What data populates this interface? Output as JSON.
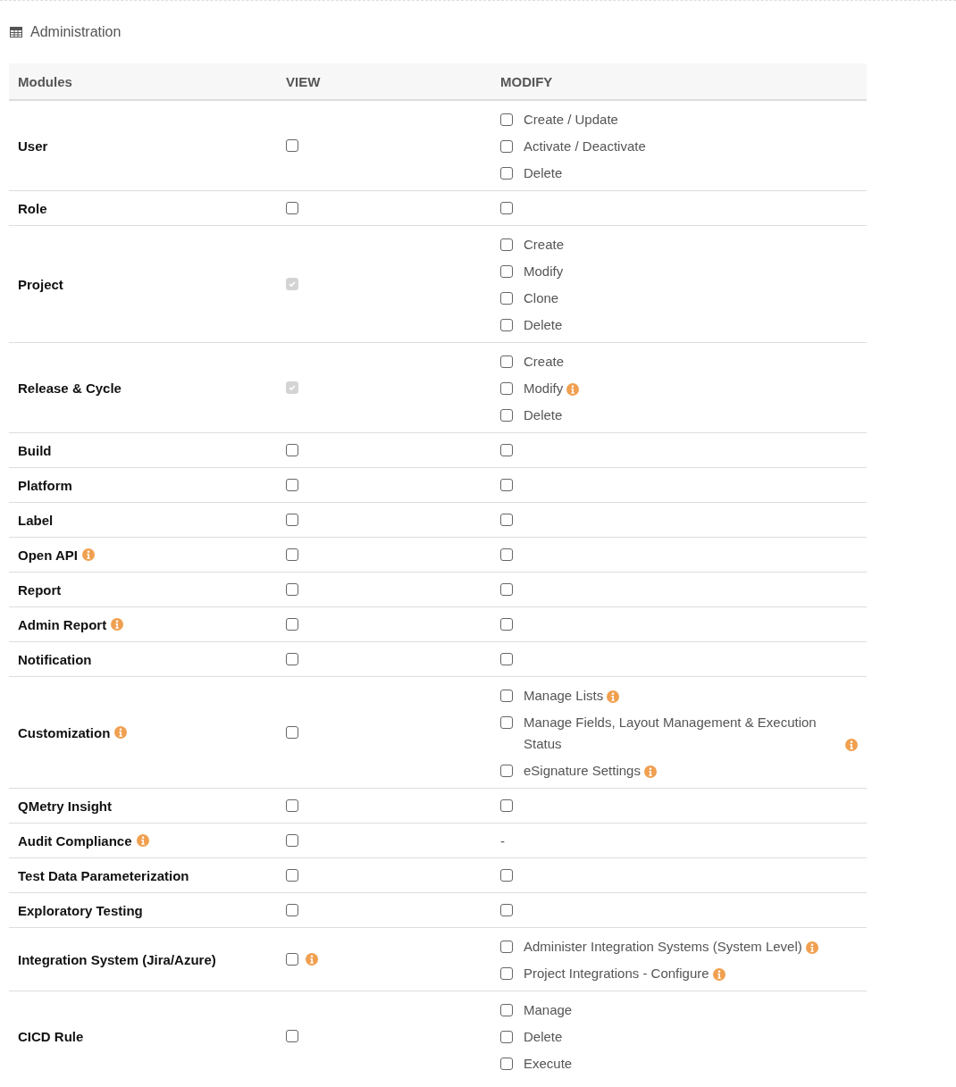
{
  "section": {
    "title": "Administration"
  },
  "columns": [
    "Modules",
    "VIEW",
    "MODIFY"
  ],
  "rows": [
    {
      "module": "User",
      "info": false,
      "view": {
        "checked": false,
        "disabled": false,
        "info": false
      },
      "modify": {
        "kind": "options",
        "options": [
          {
            "label": "Create / Update",
            "checked": false,
            "info": false
          },
          {
            "label": "Activate / Deactivate",
            "checked": false,
            "info": false
          },
          {
            "label": "Delete",
            "checked": false,
            "info": false
          }
        ]
      }
    },
    {
      "module": "Role",
      "info": false,
      "view": {
        "checked": false,
        "disabled": false,
        "info": false
      },
      "modify": {
        "kind": "checkbox",
        "checked": false
      }
    },
    {
      "module": "Project",
      "info": false,
      "view": {
        "checked": true,
        "disabled": true,
        "info": false
      },
      "modify": {
        "kind": "options",
        "options": [
          {
            "label": "Create",
            "checked": false,
            "info": false
          },
          {
            "label": "Modify",
            "checked": false,
            "info": false
          },
          {
            "label": "Clone",
            "checked": false,
            "info": false
          },
          {
            "label": "Delete",
            "checked": false,
            "info": false
          }
        ]
      }
    },
    {
      "module": "Release & Cycle",
      "info": false,
      "view": {
        "checked": true,
        "disabled": true,
        "info": false
      },
      "modify": {
        "kind": "options",
        "options": [
          {
            "label": "Create",
            "checked": false,
            "info": false
          },
          {
            "label": "Modify",
            "checked": false,
            "info": true
          },
          {
            "label": "Delete",
            "checked": false,
            "info": false
          }
        ]
      }
    },
    {
      "module": "Build",
      "info": false,
      "view": {
        "checked": false,
        "disabled": false,
        "info": false
      },
      "modify": {
        "kind": "checkbox",
        "checked": false
      }
    },
    {
      "module": "Platform",
      "info": false,
      "view": {
        "checked": false,
        "disabled": false,
        "info": false
      },
      "modify": {
        "kind": "checkbox",
        "checked": false
      }
    },
    {
      "module": "Label",
      "info": false,
      "view": {
        "checked": false,
        "disabled": false,
        "info": false
      },
      "modify": {
        "kind": "checkbox",
        "checked": false
      }
    },
    {
      "module": "Open API",
      "info": true,
      "view": {
        "checked": false,
        "disabled": false,
        "info": false
      },
      "modify": {
        "kind": "checkbox",
        "checked": false
      }
    },
    {
      "module": "Report",
      "info": false,
      "view": {
        "checked": false,
        "disabled": false,
        "info": false
      },
      "modify": {
        "kind": "checkbox",
        "checked": false
      }
    },
    {
      "module": "Admin Report",
      "info": true,
      "view": {
        "checked": false,
        "disabled": false,
        "info": false
      },
      "modify": {
        "kind": "checkbox",
        "checked": false
      }
    },
    {
      "module": "Notification",
      "info": false,
      "view": {
        "checked": false,
        "disabled": false,
        "info": false
      },
      "modify": {
        "kind": "checkbox",
        "checked": false
      }
    },
    {
      "module": "Customization",
      "info": true,
      "view": {
        "checked": false,
        "disabled": false,
        "info": false
      },
      "modify": {
        "kind": "options",
        "options": [
          {
            "label": "Manage Lists",
            "checked": false,
            "info": true
          },
          {
            "label": "Manage Fields, Layout Management & Execution Status",
            "checked": false,
            "info": true
          },
          {
            "label": "eSignature Settings",
            "checked": false,
            "info": true
          }
        ]
      }
    },
    {
      "module": "QMetry Insight",
      "info": false,
      "view": {
        "checked": false,
        "disabled": false,
        "info": false
      },
      "modify": {
        "kind": "checkbox",
        "checked": false
      }
    },
    {
      "module": "Audit Compliance",
      "info": true,
      "view": {
        "checked": false,
        "disabled": false,
        "info": false
      },
      "modify": {
        "kind": "text",
        "text": "-"
      }
    },
    {
      "module": "Test Data Parameterization",
      "info": false,
      "view": {
        "checked": false,
        "disabled": false,
        "info": false
      },
      "modify": {
        "kind": "checkbox",
        "checked": false
      }
    },
    {
      "module": "Exploratory Testing",
      "info": false,
      "view": {
        "checked": false,
        "disabled": false,
        "info": false
      },
      "modify": {
        "kind": "checkbox",
        "checked": false
      }
    },
    {
      "module": "Integration System (Jira/Azure)",
      "info": false,
      "view": {
        "checked": false,
        "disabled": false,
        "info": true
      },
      "modify": {
        "kind": "options",
        "options": [
          {
            "label": "Administer Integration Systems (System Level)",
            "checked": false,
            "info": true
          },
          {
            "label": "Project Integrations - Configure",
            "checked": false,
            "info": true
          }
        ]
      }
    },
    {
      "module": "CICD Rule",
      "info": false,
      "view": {
        "checked": false,
        "disabled": false,
        "info": false
      },
      "modify": {
        "kind": "options",
        "options": [
          {
            "label": "Manage",
            "checked": false,
            "info": false
          },
          {
            "label": "Delete",
            "checked": false,
            "info": false
          },
          {
            "label": "Execute",
            "checked": false,
            "info": false
          }
        ]
      }
    }
  ]
}
